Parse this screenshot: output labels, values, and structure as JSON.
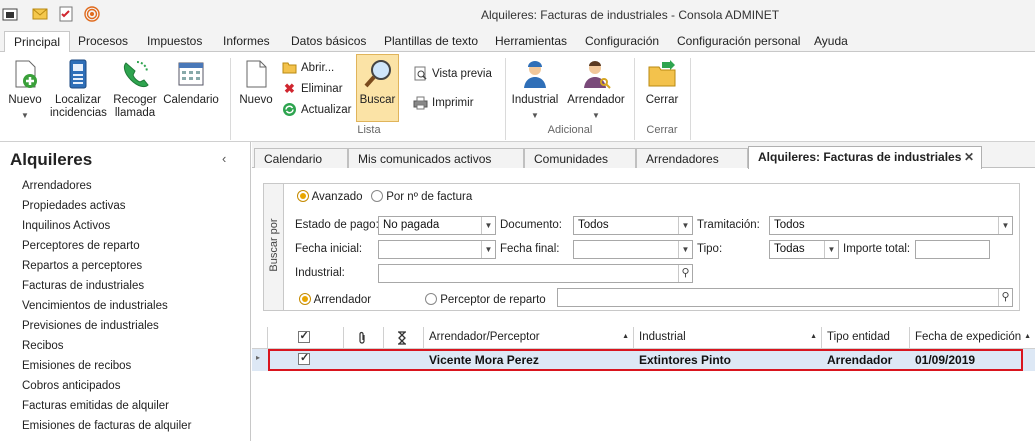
{
  "window": {
    "title": "Alquileres: Facturas de industriales - Consola ADMINET"
  },
  "menu": {
    "tabs": [
      "Principal",
      "Procesos",
      "Impuestos",
      "Informes",
      "Datos básicos",
      "Plantillas de texto",
      "Herramientas",
      "Configuración",
      "Configuración personal",
      "Ayuda"
    ]
  },
  "ribbon": {
    "nuevo": "Nuevo",
    "localizar_1": "Localizar",
    "localizar_2": "incidencias",
    "recoger_1": "Recoger",
    "recoger_2": "llamada",
    "calendario": "Calendario",
    "nuevo2": "Nuevo",
    "abrir": "Abrir...",
    "eliminar": "Eliminar",
    "actualizar": "Actualizar",
    "buscar": "Buscar",
    "vista_previa": "Vista previa",
    "imprimir": "Imprimir",
    "industrial": "Industrial",
    "arrendador": "Arrendador",
    "cerrar": "Cerrar",
    "group_lista": "Lista",
    "group_adicional": "Adicional",
    "group_cerrar": "Cerrar"
  },
  "sidebar": {
    "title": "Alquileres",
    "collapse_icon": "chevron-left",
    "items": [
      "Arrendadores",
      "Propiedades activas",
      "Inquilinos Activos",
      "Perceptores de reparto",
      "Repartos a perceptores",
      "Facturas de industriales",
      "Vencimientos de industriales",
      "Previsiones de industriales",
      "Recibos",
      "Emisiones de recibos",
      "Cobros anticipados",
      "Facturas emitidas de alquiler",
      "Emisiones de facturas de alquiler"
    ]
  },
  "doc_tabs": [
    "Calendario",
    "Mis comunicados activos",
    "Comunidades",
    "Arrendadores",
    "Alquileres: Facturas de industriales"
  ],
  "search": {
    "vertical_label": "Buscar por",
    "mode_advanced": "Avanzado",
    "mode_number": "Por nº de factura",
    "estado_label": "Estado de pago:",
    "estado_value": "No pagada",
    "documento_label": "Documento:",
    "documento_value": "Todos",
    "tramitacion_label": "Tramitación:",
    "tramitacion_value": "Todos",
    "fecha_inicial_label": "Fecha inicial:",
    "fecha_inicial_value": "",
    "fecha_final_label": "Fecha final:",
    "fecha_final_value": "",
    "tipo_label": "Tipo:",
    "tipo_value": "Todas",
    "importe_label": "Importe total:",
    "importe_value": "",
    "industrial_label": "Industrial:",
    "industrial_value": "",
    "radio_arrendador": "Arrendador",
    "radio_perceptor": "Perceptor de reparto",
    "perceptor_value": ""
  },
  "grid": {
    "columns": [
      "Arrendador/Perceptor",
      "Industrial",
      "Tipo entidad",
      "Fecha de expedición"
    ],
    "rows": [
      {
        "arrendador": "Vicente Mora Perez",
        "industrial": "Extintores Pinto",
        "tipo": "Arrendador",
        "fecha": "01/09/2019"
      }
    ]
  },
  "colors": {
    "accent_blue": "#2b5797",
    "highlight_row": "#dde8f5",
    "row_border": "#d9151e",
    "buscar_active": "#fbe3a6"
  }
}
